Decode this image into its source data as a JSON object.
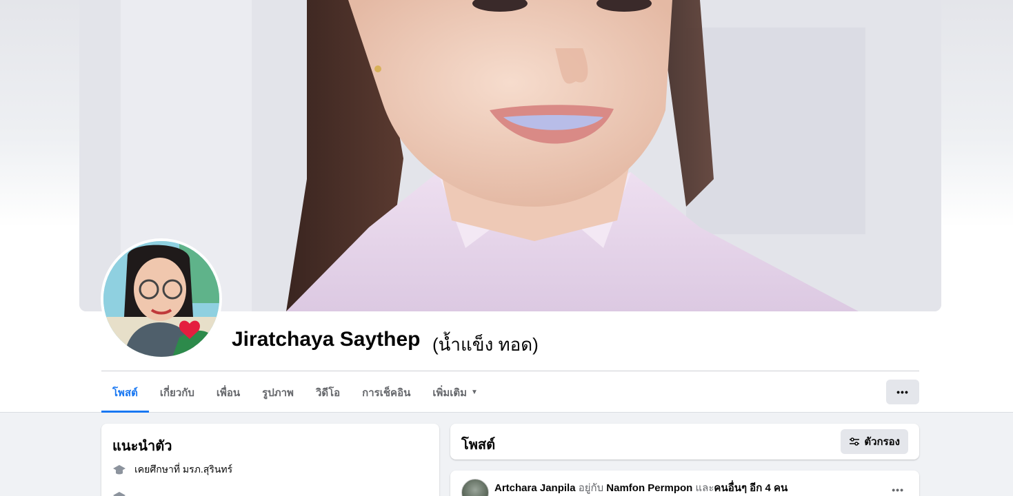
{
  "profile": {
    "name": "Jiratchaya Saythep",
    "alternate_name": "(น้ำแข็ง ทอด)"
  },
  "tabs": [
    {
      "label": "โพสต์",
      "active": true
    },
    {
      "label": "เกี่ยวกับ",
      "active": false
    },
    {
      "label": "เพื่อน",
      "active": false
    },
    {
      "label": "รูปภาพ",
      "active": false
    },
    {
      "label": "วิดีโอ",
      "active": false
    },
    {
      "label": "การเช็คอิน",
      "active": false
    },
    {
      "label": "เพิ่มเติม",
      "active": false,
      "has_dropdown": true
    }
  ],
  "more_button": {
    "label": "•••"
  },
  "intro": {
    "title": "แนะนำตัว",
    "items": [
      {
        "icon": "graduation-cap-icon",
        "text": "เคยศึกษาที่ มรภ.สุรินทร์"
      }
    ]
  },
  "posts": {
    "title": "โพสต์",
    "filter_label": "ตัวกรอง",
    "filter_icon": "sliders-icon"
  },
  "feed": {
    "first_post": {
      "author": "Artchara Janpila",
      "with_text": "อยู่กับ",
      "tagged": "Namfon Permpon",
      "and_text": "และ",
      "others": "คนอื่นๆ อีก 4 คน",
      "more": "•••"
    }
  },
  "colors": {
    "accent": "#1877f2",
    "page_bg": "#f0f2f5",
    "button_bg": "#e4e6eb",
    "secondary_text": "#65676b"
  }
}
